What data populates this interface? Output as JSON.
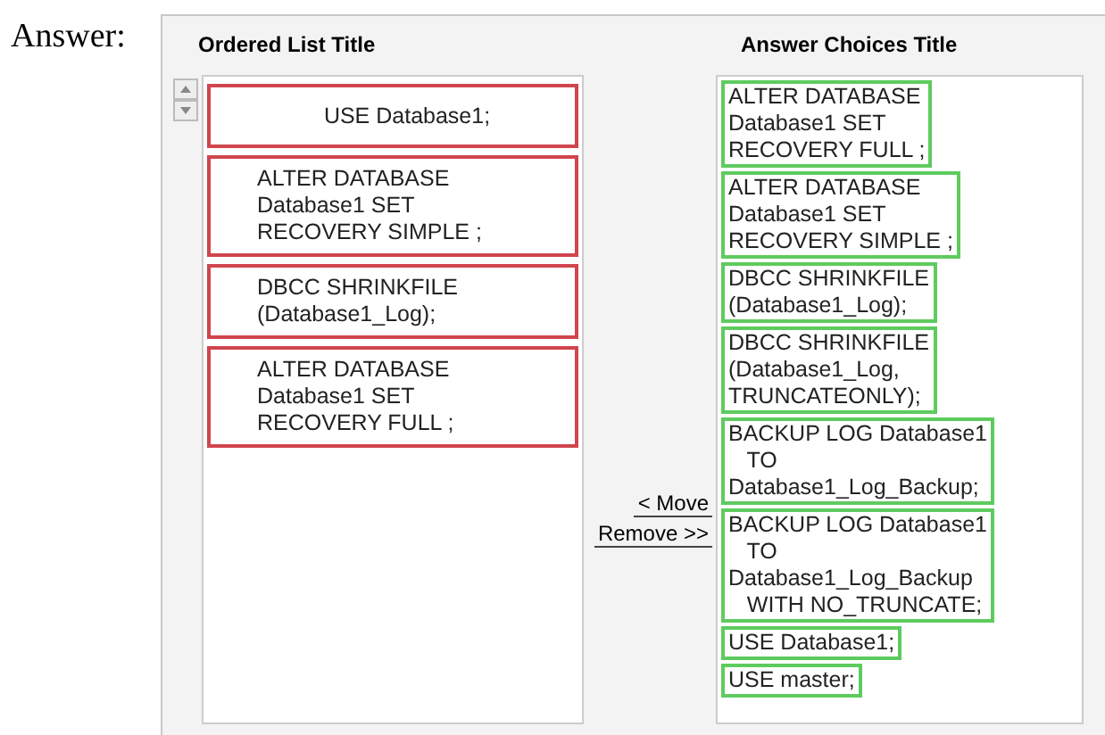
{
  "label": "Answer:",
  "ordered_list": {
    "title": "Ordered List Title",
    "items": [
      {
        "text": "USE Database1;"
      },
      {
        "text": "ALTER DATABASE\nDatabase1 SET\nRECOVERY SIMPLE ;"
      },
      {
        "text": "DBCC SHRINKFILE\n(Database1_Log);"
      },
      {
        "text": "ALTER DATABASE\nDatabase1 SET\nRECOVERY FULL ;"
      }
    ]
  },
  "buttons": [
    "< Move",
    "Remove >>"
  ],
  "answer_choices": {
    "title": "Answer Choices Title",
    "items": [
      {
        "text": "ALTER DATABASE\nDatabase1 SET\nRECOVERY FULL ;"
      },
      {
        "text": "ALTER DATABASE\nDatabase1 SET\nRECOVERY SIMPLE ;"
      },
      {
        "text": "DBCC SHRINKFILE\n(Database1_Log);"
      },
      {
        "text": "DBCC SHRINKFILE\n(Database1_Log,\nTRUNCATEONLY);"
      },
      {
        "text": "BACKUP LOG Database1\n   TO\nDatabase1_Log_Backup;"
      },
      {
        "text": "BACKUP LOG Database1\n   TO\nDatabase1_Log_Backup\n   WITH NO_TRUNCATE;"
      },
      {
        "text": "USE Database1;"
      },
      {
        "text": "USE master;"
      }
    ]
  }
}
